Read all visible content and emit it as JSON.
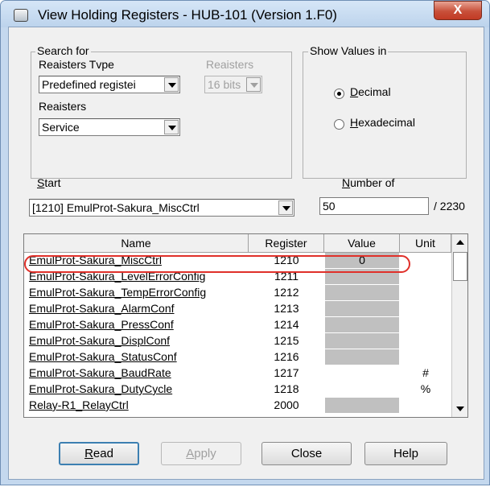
{
  "window": {
    "title": "View Holding Registers - HUB-101 (Version 1.F0)",
    "close_glyph": "X"
  },
  "search": {
    "group_label": "Search for",
    "registers_type_label": "Reaisters Tvpe",
    "registers_type_value": "Predefined registei",
    "registers_bits_label": "Reaisters",
    "registers_bits_value": "16 bits",
    "registers_label": "Reaisters",
    "registers_value": "Service"
  },
  "show_values": {
    "group_label": "Show Values in",
    "decimal_label_u": "D",
    "decimal_label_rest": "ecimal",
    "hex_label_u": "H",
    "hex_label_rest": "exadecimal",
    "selected": "Decimal"
  },
  "start": {
    "label_u": "S",
    "label_rest": "tart",
    "value": "[1210] EmulProt-Sakura_MiscCtrl"
  },
  "number_of": {
    "label_u": "N",
    "label_rest": "umber of",
    "value": "50",
    "total": "/ 2230"
  },
  "table": {
    "headers": {
      "name": "Name",
      "register": "Register",
      "value": "Value",
      "unit": "Unit"
    },
    "rows": [
      {
        "name": "EmulProt-Sakura_MiscCtrl",
        "register": "1210",
        "value": "0",
        "unit": "",
        "gray": true
      },
      {
        "name": "EmulProt-Sakura_LevelErrorConfig",
        "register": "1211",
        "value": "",
        "unit": "",
        "gray": true
      },
      {
        "name": "EmulProt-Sakura_TempErrorConfig",
        "register": "1212",
        "value": "",
        "unit": "",
        "gray": true
      },
      {
        "name": "EmulProt-Sakura_AlarmConf",
        "register": "1213",
        "value": "",
        "unit": "",
        "gray": true
      },
      {
        "name": "EmulProt-Sakura_PressConf",
        "register": "1214",
        "value": "",
        "unit": "",
        "gray": true
      },
      {
        "name": "EmulProt-Sakura_DisplConf",
        "register": "1215",
        "value": "",
        "unit": "",
        "gray": true
      },
      {
        "name": "EmulProt-Sakura_StatusConf",
        "register": "1216",
        "value": "",
        "unit": "",
        "gray": true
      },
      {
        "name": "EmulProt-Sakura_BaudRate",
        "register": "1217",
        "value": "",
        "unit": "#",
        "gray": false
      },
      {
        "name": "EmulProt-Sakura_DutyCycle",
        "register": "1218",
        "value": "",
        "unit": "%",
        "gray": false
      },
      {
        "name": "Relay-R1_RelayCtrl",
        "register": "2000",
        "value": "",
        "unit": "",
        "gray": true
      }
    ]
  },
  "buttons": {
    "read_u": "R",
    "read_rest": "ead",
    "apply_u": "A",
    "apply_rest": "pply",
    "close": "Close",
    "help": "Help"
  },
  "colors": {
    "highlight": "#e0302a",
    "value_cell_gray": "#c0c0c0"
  }
}
